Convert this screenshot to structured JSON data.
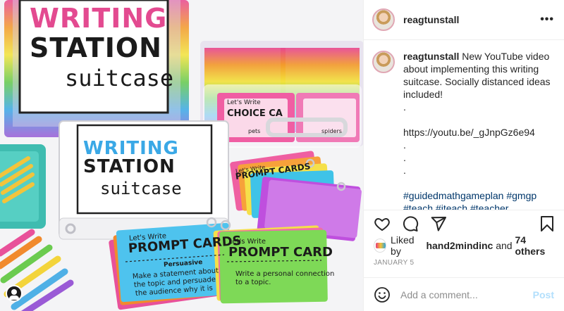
{
  "post": {
    "photo": {
      "title_top": "WRITING",
      "station_top": "STATION",
      "suitcase_top": "suitcase",
      "title_binder": "WRITING",
      "station_binder": "STATION",
      "suitcase_binder": "suitcase",
      "lets_write_1": "Let's Write",
      "choice_cards": "CHOICE CA",
      "word_pets": "pets",
      "word_spiders": "spiders",
      "lets_write_2": "Let's Write",
      "prompt_cards_1": "PROMPT CARDS",
      "persuasive": "Persuasive",
      "persuasive_text_1": "Make a statement about",
      "persuasive_text_2": "the topic and persuade",
      "persuasive_text_3": "the audience why it is",
      "lets_write_3": "Let's Write",
      "prompt_cards_2": "PROMPT CARD",
      "green_text_1": "Write a personal connection",
      "green_text_2": "to a topic.",
      "lets_write_4": "Let's Write",
      "prompt_cards_3": "PROMPT CARDS"
    },
    "header": {
      "username": "reagtunstall",
      "more": "•••"
    },
    "caption": {
      "username": "reagtunstall",
      "text_1": "New YouTube video about implementing this writing suitcase. Socially distanced ideas included!",
      "dot_1": ".",
      "link": "https://youtu.be/_gJnpGz6e94",
      "dot_2": ".",
      "dot_3": ".",
      "dot_4": ".",
      "hashtags": "#guidedmathgameplan #gmgp #teach #iteach #teacher #teachersofinstagram #teachersfollow #iteachk #iteachkinder #iteachfirst #iteachsecond #iteachthird #iteachfourth #iteachfifth #smallgroup"
    },
    "likes": {
      "prefix": "Liked by",
      "user": "hand2mindinc",
      "conjunction": "and",
      "others": "74 others"
    },
    "date": "JANUARY 5",
    "comment": {
      "placeholder": "Add a comment...",
      "post_label": "Post"
    },
    "colors": {
      "hashtag": "#00376b",
      "post_disabled": "#b2dffc",
      "meta_gray": "#8e8e8e"
    },
    "icons": [
      "heart-icon",
      "comment-icon",
      "share-icon",
      "bookmark-icon",
      "emoji-icon",
      "more-icon"
    ]
  }
}
